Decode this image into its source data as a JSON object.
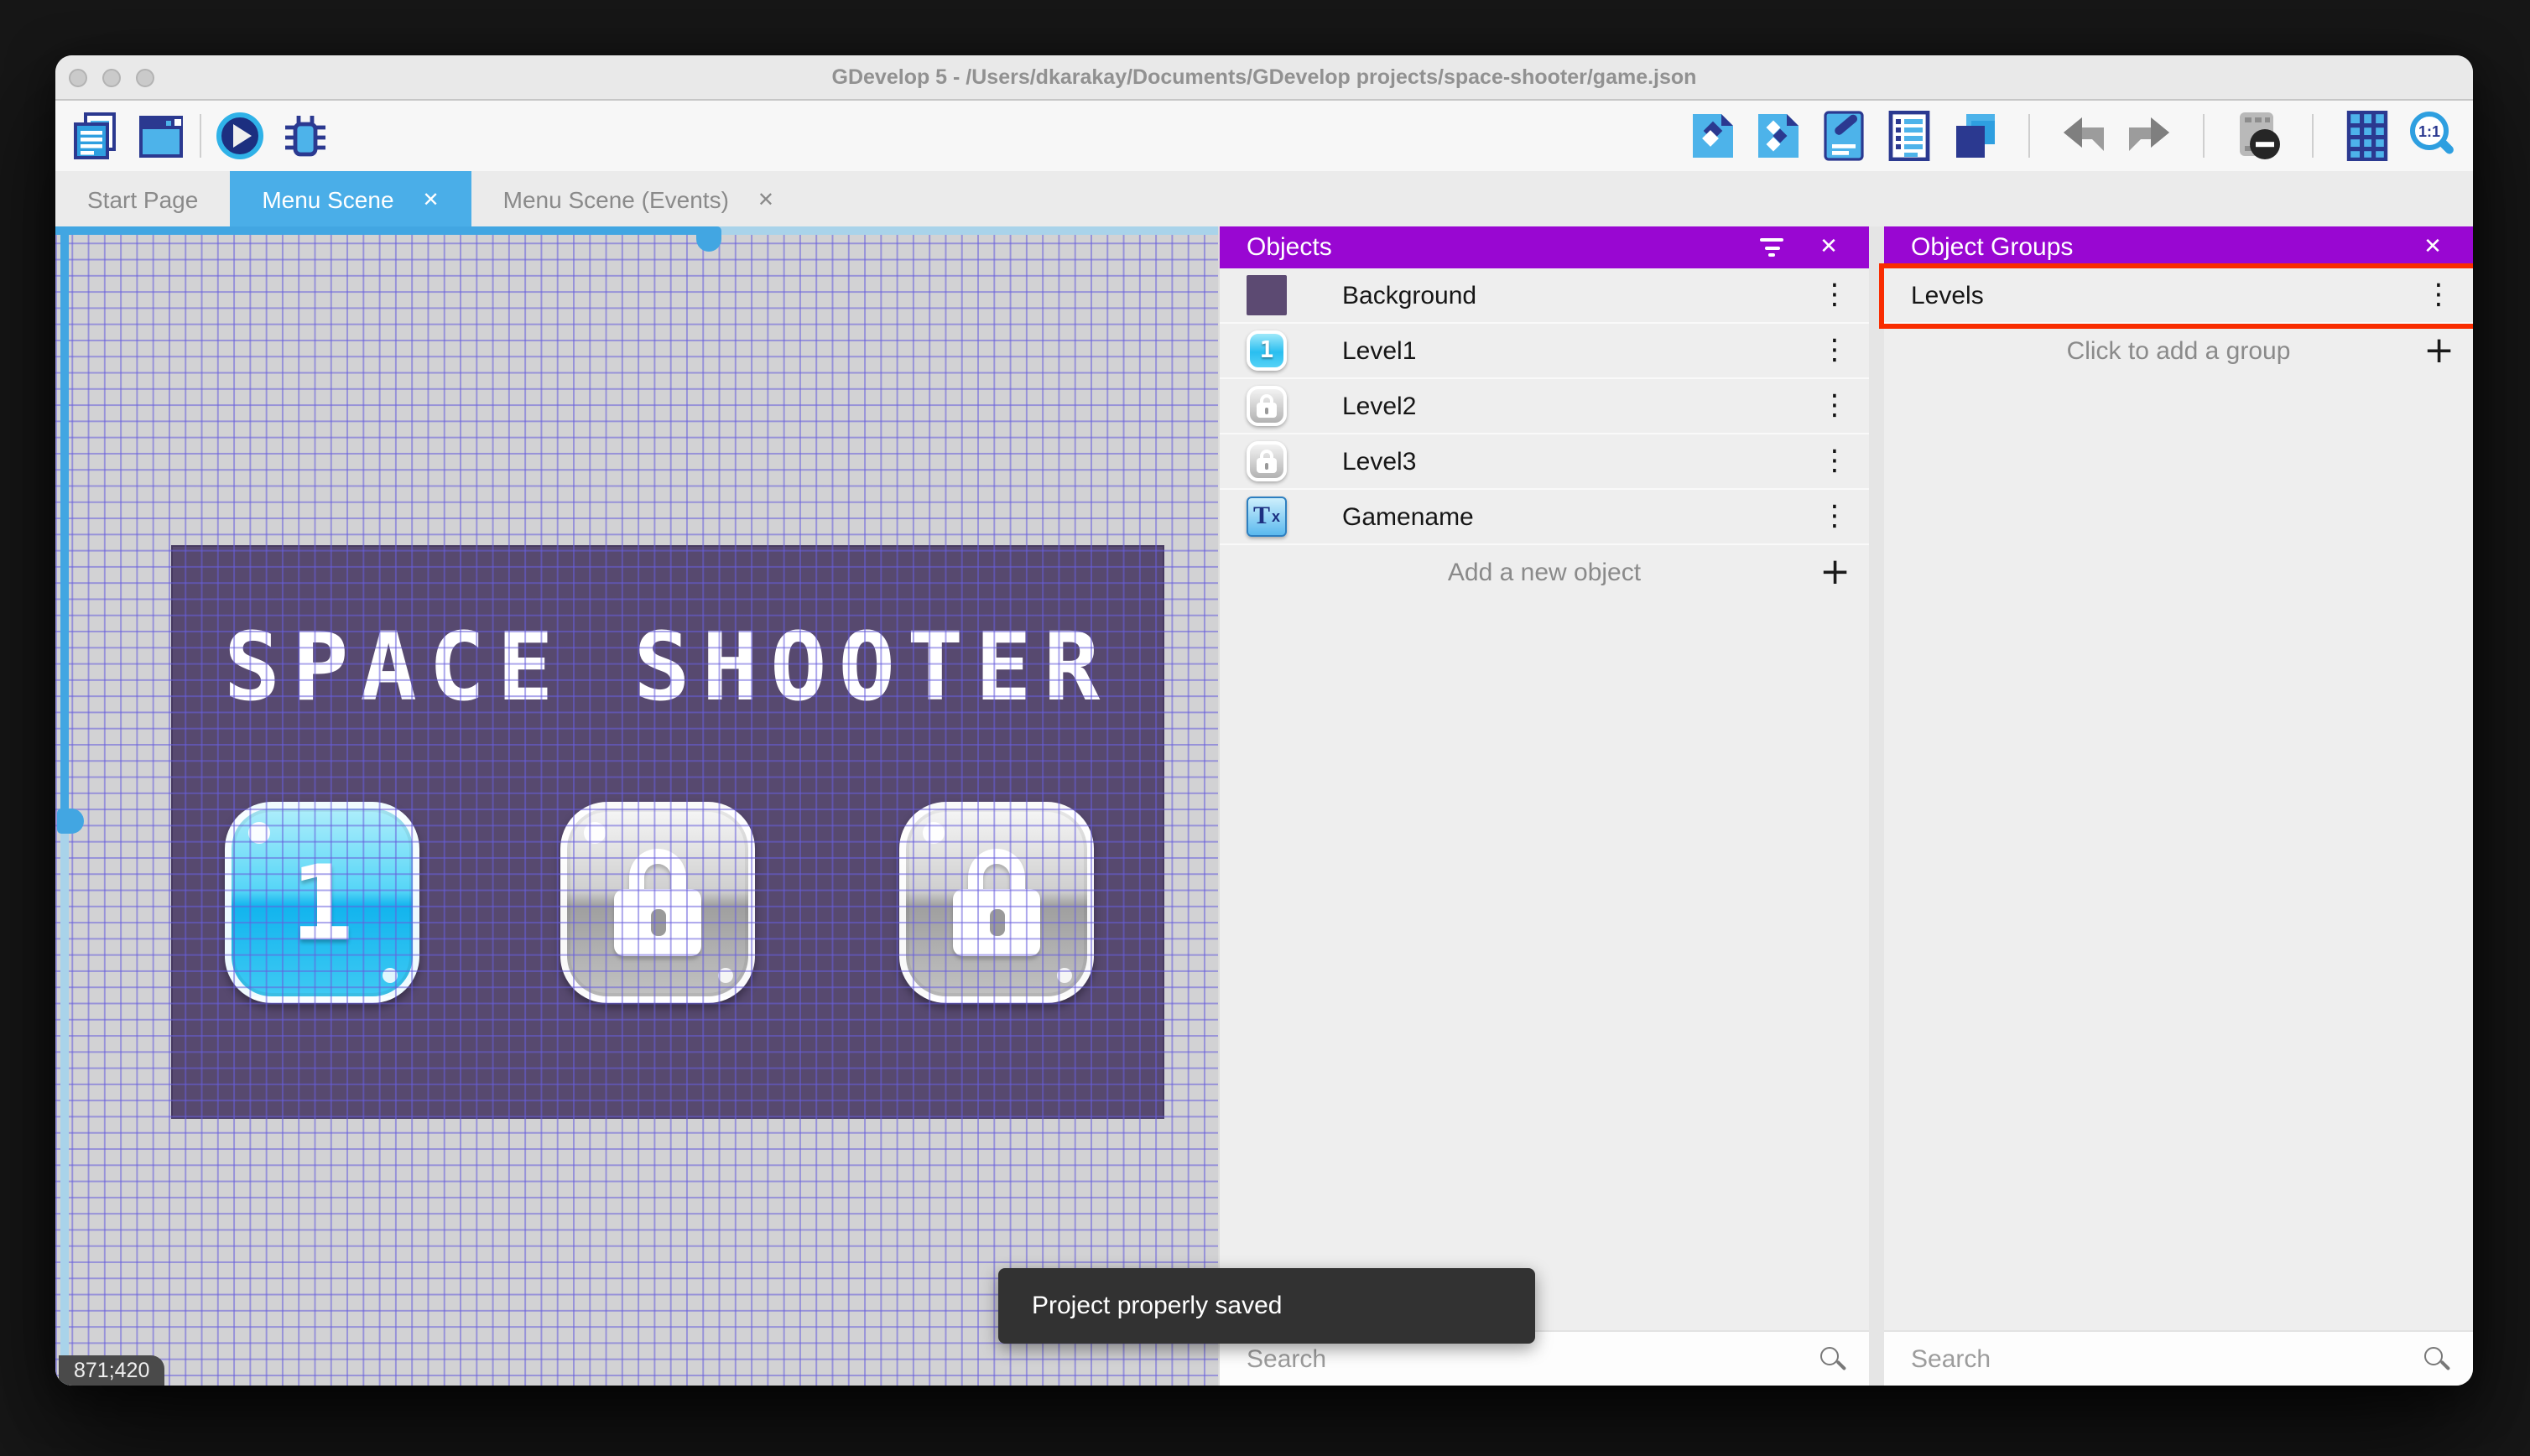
{
  "window": {
    "title": "GDevelop 5 - /Users/dkarakay/Documents/GDevelop projects/space-shooter/game.json",
    "traffic_lights": [
      "close",
      "minimize",
      "zoom"
    ]
  },
  "toolbar": {
    "left_icons": [
      "project-manager-icon",
      "scene-window-icon",
      "play-icon",
      "debug-icon"
    ],
    "right_icons": [
      "objects-panel-icon",
      "object-groups-panel-icon",
      "properties-panel-icon",
      "instances-list-icon",
      "layers-panel-icon",
      "undo-icon",
      "redo-icon",
      "render-mask-icon",
      "grid-icon",
      "zoom-original-icon"
    ]
  },
  "tabs": [
    {
      "label": "Start Page",
      "active": false,
      "closable": false
    },
    {
      "label": "Menu Scene",
      "active": true,
      "closable": true
    },
    {
      "label": "Menu Scene (Events)",
      "active": false,
      "closable": true
    }
  ],
  "canvas": {
    "coordinates_badge": "871;420",
    "scene_title": "SPACE SHOOTER",
    "level_buttons": [
      {
        "label": "1",
        "state": "unlocked"
      },
      {
        "label": "",
        "state": "locked"
      },
      {
        "label": "",
        "state": "locked"
      }
    ]
  },
  "objects_panel": {
    "title": "Objects",
    "items": [
      {
        "name": "Background",
        "icon": "background-swatch"
      },
      {
        "name": "Level1",
        "icon": "level1-button-sprite"
      },
      {
        "name": "Level2",
        "icon": "locked-button-sprite"
      },
      {
        "name": "Level3",
        "icon": "locked-button-sprite"
      },
      {
        "name": "Gamename",
        "icon": "text-object"
      }
    ],
    "add_row_label": "Add a new object",
    "search_placeholder": "Search"
  },
  "object_groups_panel": {
    "title": "Object Groups",
    "groups": [
      {
        "name": "Levels",
        "highlighted": true
      }
    ],
    "add_row_label": "Click to add a group",
    "search_placeholder": "Search"
  },
  "toast": {
    "message": "Project properly saved"
  },
  "glyphs": {
    "close": "✕",
    "kebab": "⋮",
    "plus": "+"
  },
  "colors": {
    "panel_header": "#9907d2",
    "active_tab": "#4aaee8",
    "annotation_red": "#f92c00",
    "canvas_bg": "#d2d2d4",
    "grid_line": "#675edc",
    "scene_bg": "#57496f",
    "toast_bg": "#323232",
    "scrollbar_blue": "#42a6e2"
  }
}
